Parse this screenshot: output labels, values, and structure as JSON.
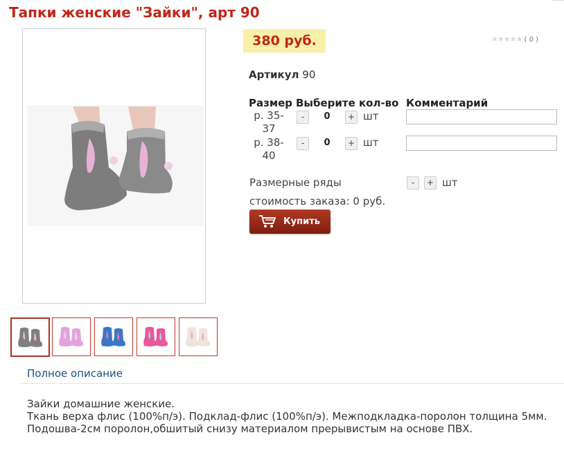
{
  "title": "Тапки женские \"Зайки\", арт 90",
  "price": "380 руб.",
  "rating": {
    "stars": "★★★★★",
    "count": "( 0 )"
  },
  "article": {
    "label": "Артикул",
    "value": "90"
  },
  "table": {
    "headers": [
      "Размер",
      "Выберите кол-во",
      "Комментарий"
    ],
    "rows": [
      {
        "size": "р. 35-37",
        "qty": "0",
        "unit": "шт",
        "comment": ""
      },
      {
        "size": "р. 38-40",
        "qty": "0",
        "unit": "шт",
        "comment": ""
      }
    ],
    "minus": "-",
    "plus": "+"
  },
  "size_rows": {
    "label": "Размерные ряды",
    "unit": "шт"
  },
  "order_cost": "стоимость заказа: 0 руб.",
  "buy_label": "Купить",
  "thumbnails": [
    {
      "color": "#808080",
      "accent": "#e9b3d8"
    },
    {
      "color": "#e2a3dd",
      "accent": "#f5d0ef"
    },
    {
      "color": "#3a78c6",
      "accent": "#e56fa8"
    },
    {
      "color": "#e8589a",
      "accent": "#9ad0e8"
    },
    {
      "color": "#efe4dc",
      "accent": "#e8b0c8"
    }
  ],
  "desc_tab": "Полное описание",
  "description": [
    "Зайки домашние женские.",
    "Ткань верха флис (100%п/э). Подклад-флис (100%п/э). Межподкладка-поролон толщина 5мм.",
    "Подошва-2см поролон,обшитый снизу материалом прерывистым на основе ПВХ."
  ],
  "colors": {
    "title": "#c0261b",
    "price_bg": "#f7f0a8",
    "buy_bg": "#9a2b19",
    "link": "#1a4f86"
  }
}
